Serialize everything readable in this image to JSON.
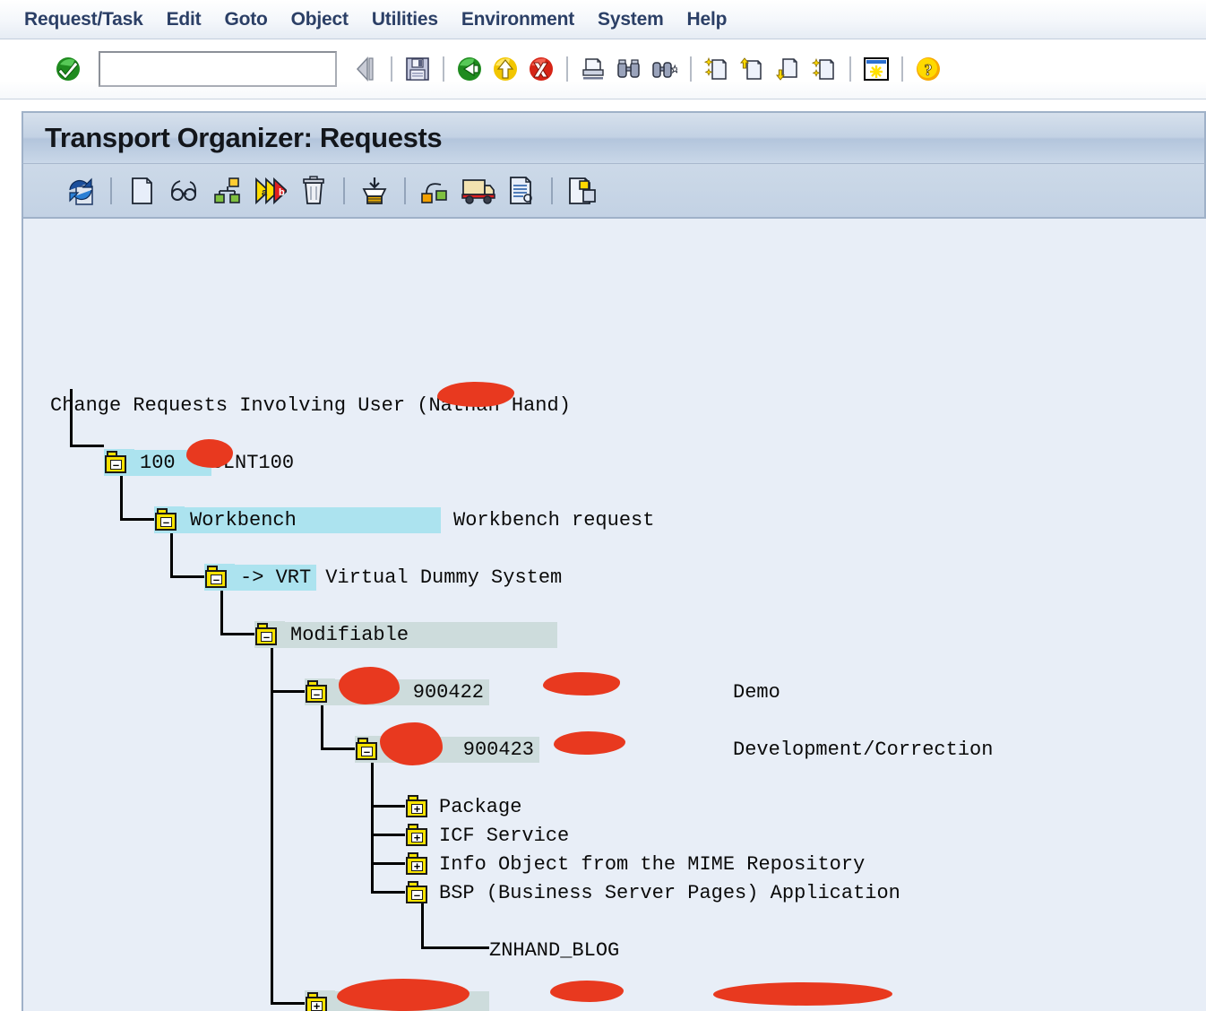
{
  "menu": {
    "items": [
      {
        "label": "Request/Task",
        "name": "menu-request-task"
      },
      {
        "label": "Edit",
        "name": "menu-edit"
      },
      {
        "label": "Goto",
        "name": "menu-goto"
      },
      {
        "label": "Object",
        "name": "menu-object"
      },
      {
        "label": "Utilities",
        "name": "menu-utilities"
      },
      {
        "label": "Environment",
        "name": "menu-environment"
      },
      {
        "label": "System",
        "name": "menu-system"
      },
      {
        "label": "Help",
        "name": "menu-help"
      }
    ]
  },
  "system_toolbar": {
    "command_field": {
      "value": "",
      "placeholder": ""
    },
    "icons": [
      "enter-checkmark-icon",
      "back-arrow-icon",
      "save-icon",
      "back-green-icon",
      "exit-yellow-up-icon",
      "cancel-red-icon",
      "print-icon",
      "find-icon",
      "find-next-icon",
      "first-page-icon",
      "previous-page-icon",
      "next-page-icon",
      "last-page-icon",
      "customize-local-layout-icon",
      "help-icon"
    ]
  },
  "window": {
    "title": "Transport Organizer: Requests"
  },
  "app_toolbar": {
    "icons": [
      "refresh-icon",
      "create-request-icon",
      "display-icon",
      "object-list-icon",
      "release-icon",
      "delete-icon",
      "release-directly-icon",
      "objects-icon",
      "transport-truck-icon",
      "logs-icon",
      "copy-icon"
    ]
  },
  "tree": {
    "root": {
      "prefix": "Change Requests Involving User ",
      "redacted": "",
      "suffix": "(Nathan Hand)",
      "full": "Change Requests Involving User  (Nathan Hand)"
    },
    "nodes": [
      {
        "id": "client",
        "state": "expanded",
        "sign": "–",
        "highlight": "cyan",
        "text": "100",
        "text2": "CLNT100",
        "description": "",
        "redacted": true
      },
      {
        "id": "workbench",
        "state": "expanded",
        "sign": "–",
        "highlight": "cyan",
        "text": "Workbench",
        "description": "Workbench request",
        "redacted": false
      },
      {
        "id": "target-system",
        "state": "expanded",
        "sign": "–",
        "highlight": "cyan",
        "text": "-> VRT",
        "description": "Virtual Dummy System",
        "redacted": false
      },
      {
        "id": "modifiable",
        "state": "expanded",
        "sign": "–",
        "highlight": "sage",
        "text": "Modifiable",
        "description": "",
        "redacted": false
      },
      {
        "id": "request-900422",
        "state": "expanded",
        "sign": "–",
        "highlight": "sage",
        "text": "900422",
        "owner": "",
        "description": "Demo",
        "redacted": true
      },
      {
        "id": "task-900423",
        "state": "expanded",
        "sign": "–",
        "highlight": "sage",
        "text": "900423",
        "owner": "",
        "description": "Development/Correction",
        "redacted": true
      },
      {
        "id": "package",
        "state": "collapsed",
        "sign": "+",
        "highlight": "none",
        "text": "Package",
        "description": "",
        "redacted": false
      },
      {
        "id": "icf-service",
        "state": "collapsed",
        "sign": "+",
        "highlight": "none",
        "text": "ICF Service",
        "description": "",
        "redacted": false
      },
      {
        "id": "mime-info-object",
        "state": "collapsed",
        "sign": "+",
        "highlight": "none",
        "text": "Info Object from the MIME Repository",
        "description": "",
        "redacted": false
      },
      {
        "id": "bsp-application",
        "state": "expanded",
        "sign": "–",
        "highlight": "none",
        "text": "BSP (Business Server Pages) Application",
        "description": "",
        "redacted": false
      },
      {
        "id": "znhand-blog",
        "state": "leaf",
        "sign": "",
        "highlight": "none",
        "text": "ZNHAND_BLOG",
        "description": "",
        "redacted": false
      },
      {
        "id": "request-last",
        "state": "collapsed",
        "sign": "+",
        "highlight": "sage",
        "text": "",
        "owner": "",
        "description": "",
        "redacted": true
      }
    ]
  },
  "colors": {
    "menu_text": "#2b3f66",
    "title_bar": "#c3d2e4",
    "content_bg": "#e8eef7",
    "highlight_cyan": "#ace3ef",
    "highlight_sage": "#cddcdc",
    "redaction": "#e8391f",
    "folder_yellow": "#f7e200"
  }
}
